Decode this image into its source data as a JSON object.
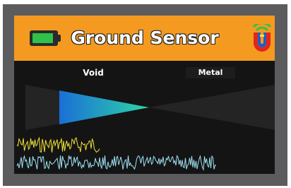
{
  "header": {
    "title": "Ground Sensor",
    "battery_level": 0.9,
    "battery_icon": "battery-icon",
    "logo_icon": "wifi-shield-logo-icon"
  },
  "indicator": {
    "left_label": "Void",
    "right_label": "Metal"
  },
  "colors": {
    "header_bg": "#f49a21",
    "bezel": "#5c5c5e",
    "screen_bg": "#141414",
    "battery_fill": "#2fc24a",
    "void_gradient_start": "#1a6fd6",
    "void_gradient_end": "#2dd4a8",
    "signal_yellow": "#f2e23a",
    "signal_blue": "#9fe3f4"
  }
}
